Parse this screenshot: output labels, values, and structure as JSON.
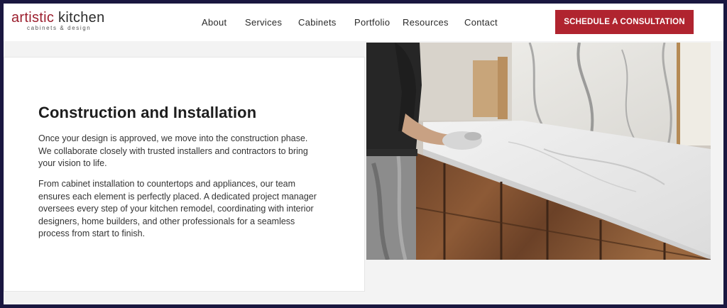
{
  "header": {
    "logo_main_accent": "artistic",
    "logo_main_rest": " kitchen",
    "logo_sub": "cabinets & design",
    "nav": [
      "About",
      "Services",
      "Cabinets",
      "Portfolio",
      "Resources",
      "Contact"
    ],
    "cta_label": "SCHEDULE A CONSULTATION"
  },
  "section": {
    "title": "Construction and Installation",
    "paragraphs": [
      "Once your design is approved, we move into the construction phase. We collaborate closely with trusted installers and contractors to bring your vision to life.",
      "From cabinet installation to countertops and appliances, our team ensures each element is perfectly placed. A dedicated project manager oversees every step of your kitchen remodel, coordinating with interior designers, home builders, and other professionals for a seamless process from start to finish."
    ]
  },
  "colors": {
    "brand": "#b0242f",
    "text": "#1d1d1d"
  }
}
